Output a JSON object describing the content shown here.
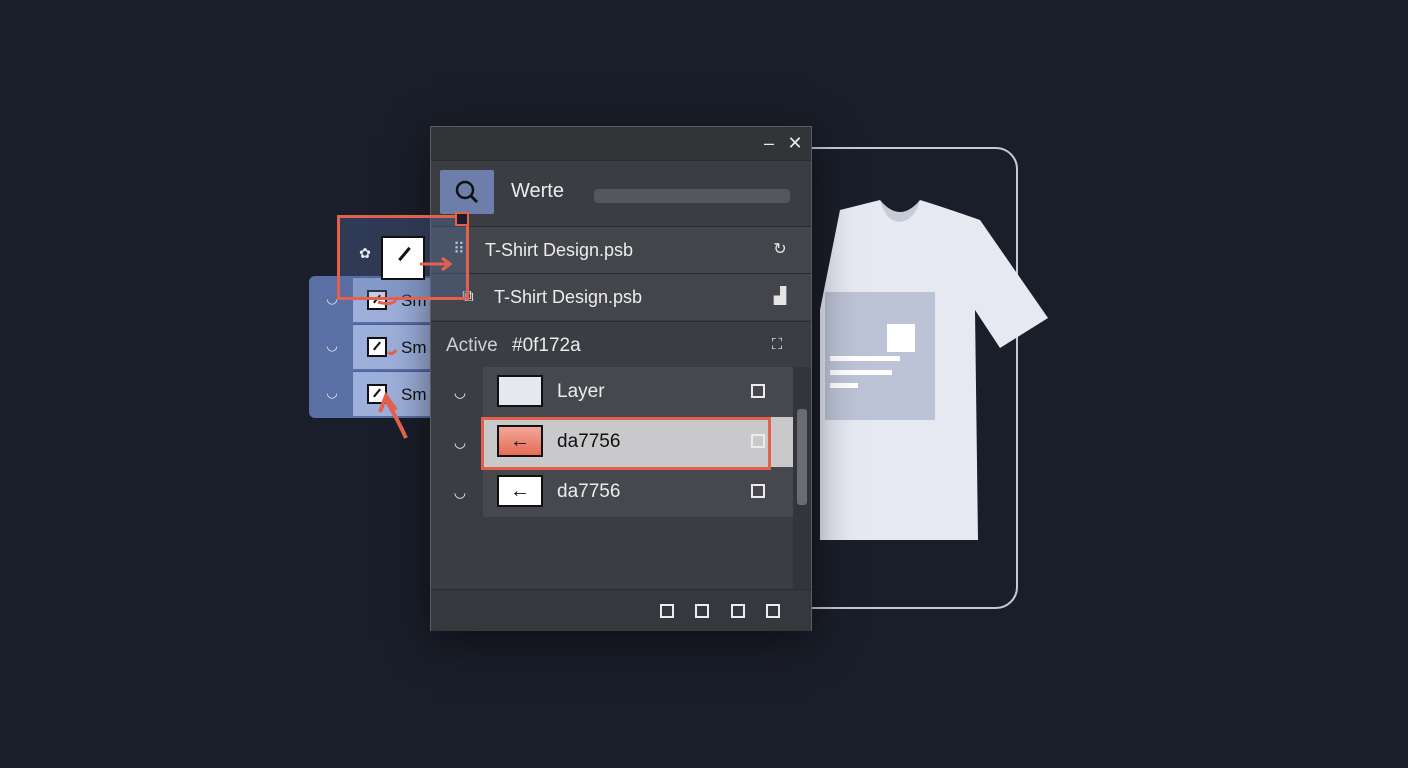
{
  "window": {
    "minimize_icon": "minimize-icon",
    "close_icon": "close-icon"
  },
  "search": {
    "label": "Werte"
  },
  "files": [
    {
      "name": "T-Shirt Design.psb",
      "left_icon": "layer-stack-icon",
      "right_icon": "refresh-icon"
    },
    {
      "name": "T-Shirt Design.psb",
      "left_icon": "document-icon",
      "right_icon": "chart-icon"
    }
  ],
  "active": {
    "label": "Active",
    "value": "#0f172a"
  },
  "layers": [
    {
      "name": "Layer",
      "selected": false,
      "thumb": "blank"
    },
    {
      "name": "da7756",
      "selected": true,
      "thumb": "arrow-left"
    },
    {
      "name": "da7756",
      "selected": false,
      "thumb": "arrow-left"
    }
  ],
  "side_list": [
    {
      "label": "Sm"
    },
    {
      "label": "Sm"
    },
    {
      "label": "Sm"
    }
  ],
  "colors": {
    "background": "#1a1e2a",
    "panel": "#3b3d42",
    "accent": "#e2614d",
    "side_list": "#5a6fa3",
    "tshirt": "#e6e9f2"
  }
}
